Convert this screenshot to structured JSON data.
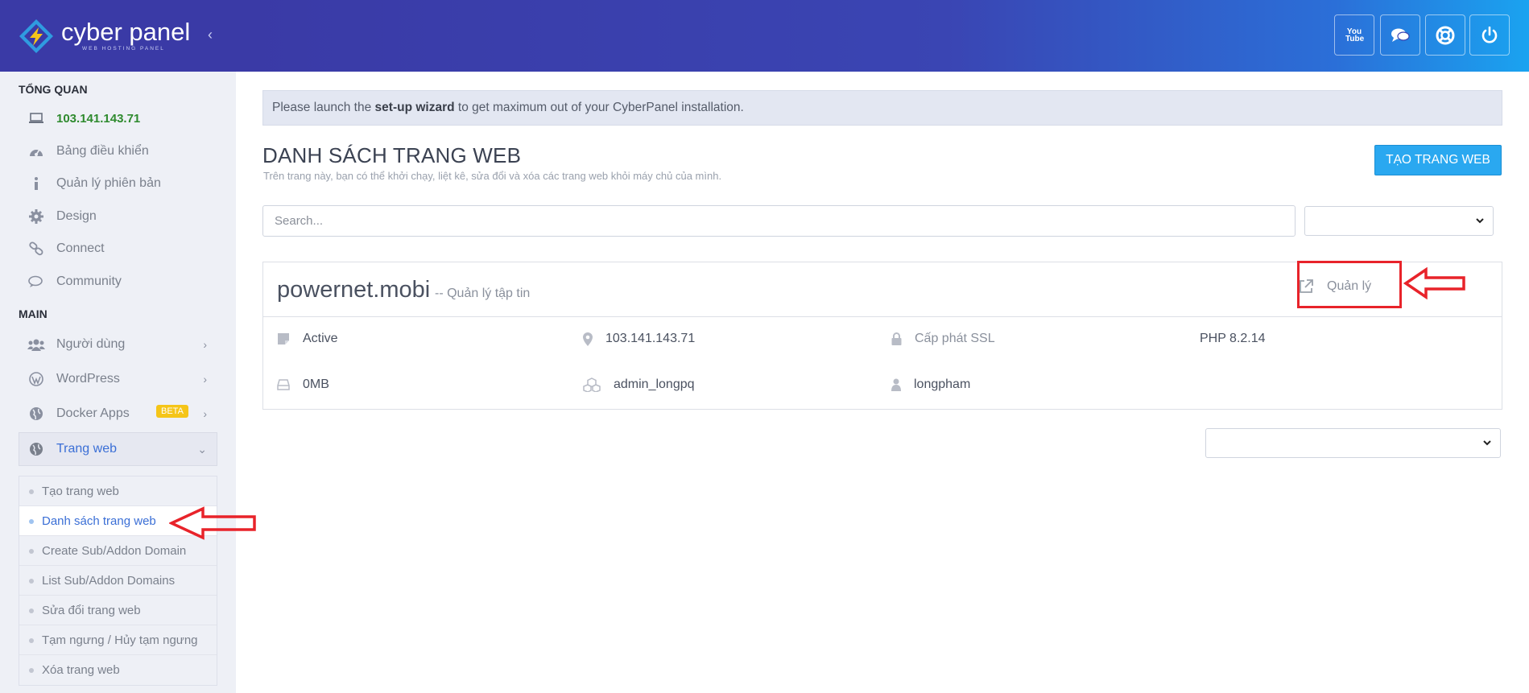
{
  "brand": {
    "name": "cyber panel",
    "tagline": "WEB HOSTING PANEL"
  },
  "sidebar": {
    "section_overview": "TỔNG QUAN",
    "ip": "103.141.143.71",
    "overview_items": [
      {
        "label": "Bảng điều khiển",
        "icon": "dashboard-icon"
      },
      {
        "label": "Quản lý phiên bản",
        "icon": "info-icon"
      },
      {
        "label": "Design",
        "icon": "gear-icon"
      },
      {
        "label": "Connect",
        "icon": "link-icon"
      },
      {
        "label": "Community",
        "icon": "chat-icon"
      }
    ],
    "section_main": "MAIN",
    "main_items": [
      {
        "label": "Người dùng",
        "icon": "users-icon"
      },
      {
        "label": "WordPress",
        "icon": "wordpress-icon"
      },
      {
        "label": "Docker Apps",
        "icon": "globe-icon",
        "badge": "BETA"
      },
      {
        "label": "Trang web",
        "icon": "globe-icon"
      }
    ],
    "submenu": [
      "Tạo trang web",
      "Danh sách trang web",
      "Create Sub/Addon Domain",
      "List Sub/Addon Domains",
      "Sửa đổi trang web",
      "Tạm ngưng / Hủy tạm ngưng",
      "Xóa trang web"
    ]
  },
  "topbar": {
    "buttons": [
      "youtube-icon",
      "chat-icon",
      "support-icon",
      "power-icon"
    ],
    "youtube_text": "You Tube"
  },
  "notice": {
    "prefix": "Please launch the ",
    "link": "set-up wizard",
    "suffix": " to get maximum out of your CyberPanel installation."
  },
  "page": {
    "title": "DANH SÁCH TRANG WEB",
    "subtitle": "Trên trang này, bạn có thể khởi chạy, liệt kê, sửa đổi và xóa các trang web khỏi máy chủ của mình.",
    "create_button": "TẠO TRANG WEB",
    "search_placeholder": "Search..."
  },
  "site": {
    "domain": "powernet.mobi",
    "file_manager": "-- Quản lý tập tin",
    "manage": "Quản lý",
    "status": "Active",
    "ip": "103.141.143.71",
    "ssl": "Cấp phát SSL",
    "php": "PHP 8.2.14",
    "disk": "0MB",
    "admin": "admin_longpq",
    "owner": "longpham"
  },
  "colors": {
    "accent": "#2aa8f0",
    "header": "#3a3aa6",
    "annotation": "#e8232a",
    "ip_green": "#2e8a2e"
  }
}
